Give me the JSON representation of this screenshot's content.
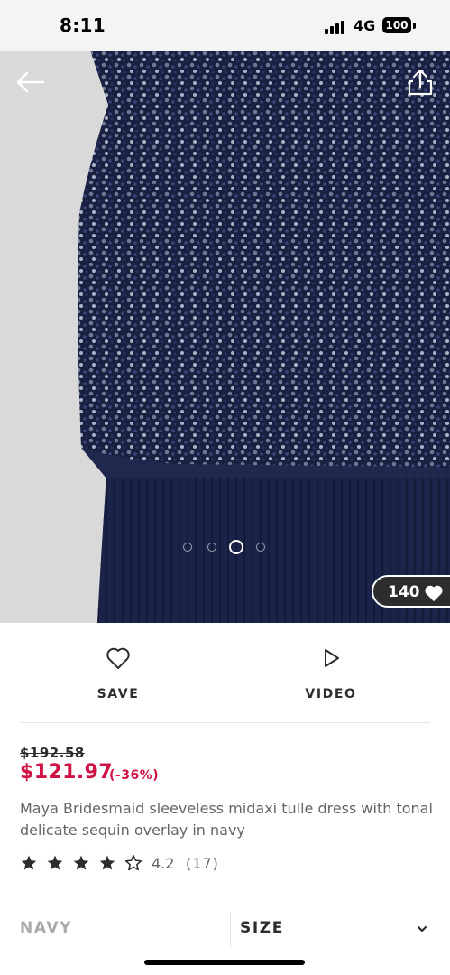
{
  "status_bar": {
    "time": "8:11",
    "network": "4G",
    "battery": "100"
  },
  "gallery": {
    "image_index": 3,
    "image_count": 4,
    "saves": "140"
  },
  "actions": {
    "save_label": "SAVE",
    "video_label": "VIDEO"
  },
  "product": {
    "old_price": "$192.58",
    "price": "$121.97",
    "discount": "(-36%)",
    "title": "Maya Bridesmaid sleeveless midaxi tulle dress with tonal delicate sequin overlay in navy",
    "rating": 4.2,
    "rating_value": "4.2",
    "rating_count": "(17)",
    "price_color": "#d01345"
  },
  "selectors": {
    "colour": "NAVY",
    "size_label": "SIZE"
  },
  "icons": [
    "back-arrow-icon",
    "share-icon",
    "heart-icon",
    "play-icon",
    "star-icon",
    "chevron-down-icon"
  ]
}
